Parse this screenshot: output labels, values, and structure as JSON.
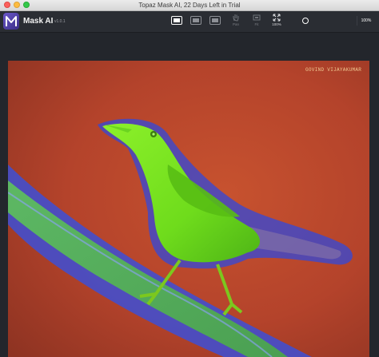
{
  "window": {
    "title": "Topaz Mask AI, 22 Days Left in Trial"
  },
  "app": {
    "name": "Mask AI",
    "version": "v1.0.1"
  },
  "toolbar": {
    "tools": {
      "pan_label": "Pan",
      "fit_label": "Fit",
      "zoom100_label": "100%"
    },
    "zoom_value": "100%"
  },
  "photo": {
    "watermark": "GOVIND VIJAYAKUMAR",
    "overlay_colors": {
      "keep": "#7cff1f",
      "cut": "#c0392b",
      "edge": "#3b4fe0"
    }
  }
}
